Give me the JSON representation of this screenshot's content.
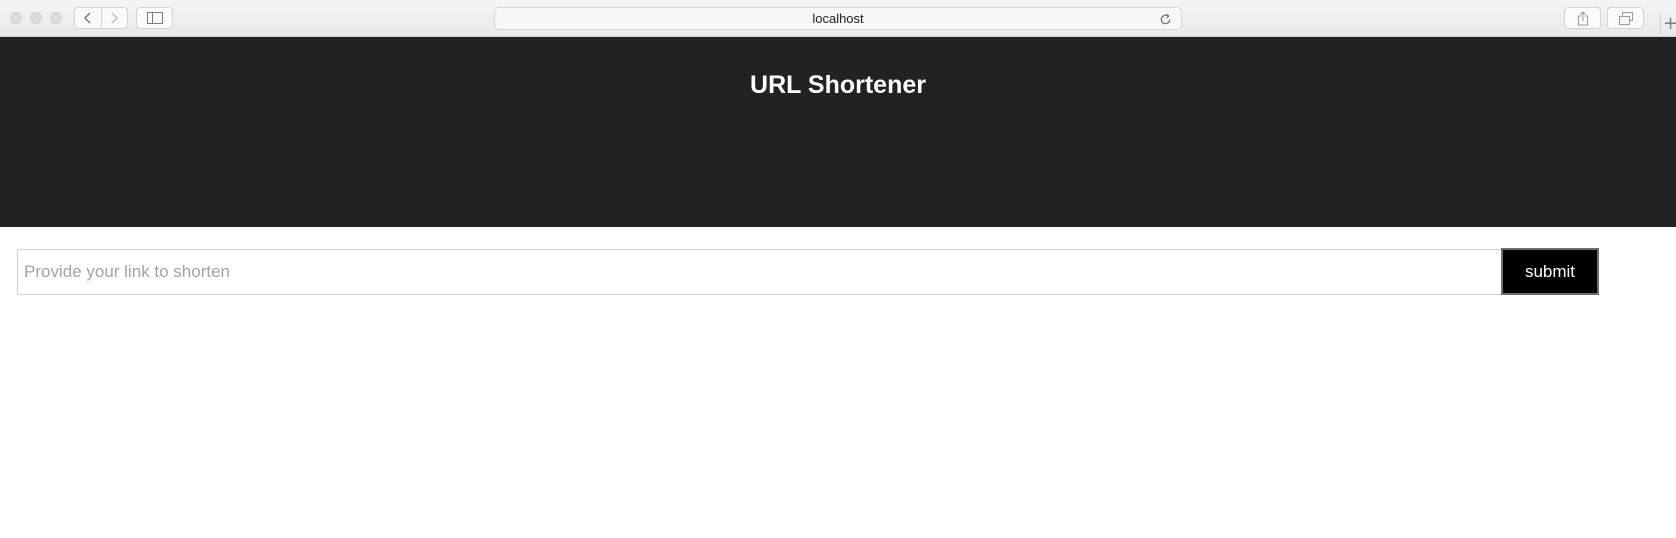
{
  "browser": {
    "address": "localhost",
    "new_tab_symbol": "+",
    "back_icon": "chevron-left-icon",
    "forward_icon": "chevron-right-icon",
    "sidebar_icon": "sidebar-icon",
    "reload_icon": "reload-icon",
    "share_icon": "share-icon",
    "tabs_icon": "tabs-overview-icon"
  },
  "header": {
    "title": "URL Shortener",
    "background_color": "#222222"
  },
  "form": {
    "input_value": "",
    "input_placeholder": "Provide your link to shorten",
    "submit_label": "submit"
  }
}
